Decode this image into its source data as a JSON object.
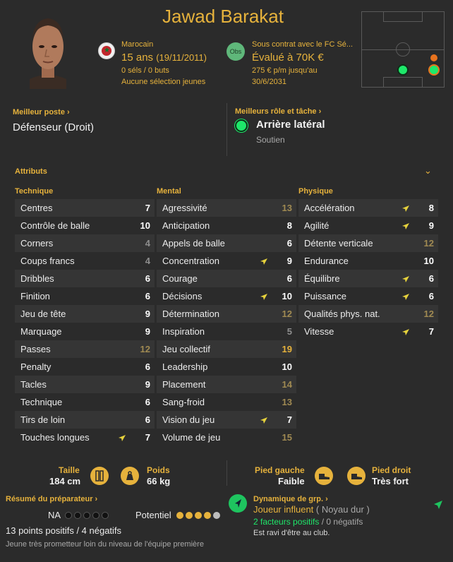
{
  "header": {
    "name": "Jawad Barakat",
    "nation": "Marocain",
    "age": "15 ans",
    "dob": "(19/11/2011)",
    "sels": "0 séls / 0 buts",
    "youth": "Aucune sélection jeunes",
    "obs_badge": "Obs",
    "contract": "Sous contrat avec le FC Sé...",
    "value": "Évalué à 70K €",
    "wage": "275 € p/m jusqu'au",
    "contract_end": "30/6/2031"
  },
  "best_position": {
    "title": "Meilleur poste",
    "value": "Défenseur (Droit)"
  },
  "best_role": {
    "title": "Meilleurs rôle et tâche",
    "value": "Arrière latéral",
    "duty": "Soutien"
  },
  "attributes": {
    "title": "Attributs",
    "columns": [
      {
        "title": "Technique",
        "rows": [
          {
            "label": "Centres",
            "value": "7",
            "tone": "hi",
            "arrow": false
          },
          {
            "label": "Contrôle de balle",
            "value": "10",
            "tone": "hi",
            "arrow": false
          },
          {
            "label": "Corners",
            "value": "4",
            "tone": "low",
            "arrow": false
          },
          {
            "label": "Coups francs",
            "value": "4",
            "tone": "low",
            "arrow": false
          },
          {
            "label": "Dribbles",
            "value": "6",
            "tone": "hi",
            "arrow": false
          },
          {
            "label": "Finition",
            "value": "6",
            "tone": "hi",
            "arrow": false
          },
          {
            "label": "Jeu de tête",
            "value": "9",
            "tone": "hi",
            "arrow": false
          },
          {
            "label": "Marquage",
            "value": "9",
            "tone": "hi",
            "arrow": false
          },
          {
            "label": "Passes",
            "value": "12",
            "tone": "mid",
            "arrow": false
          },
          {
            "label": "Penalty",
            "value": "6",
            "tone": "hi",
            "arrow": false
          },
          {
            "label": "Tacles",
            "value": "9",
            "tone": "hi",
            "arrow": false
          },
          {
            "label": "Technique",
            "value": "6",
            "tone": "hi",
            "arrow": false
          },
          {
            "label": "Tirs de loin",
            "value": "6",
            "tone": "hi",
            "arrow": false
          },
          {
            "label": "Touches longues",
            "value": "7",
            "tone": "hi",
            "arrow": true
          }
        ]
      },
      {
        "title": "Mental",
        "rows": [
          {
            "label": "Agressivité",
            "value": "13",
            "tone": "mid",
            "arrow": false
          },
          {
            "label": "Anticipation",
            "value": "8",
            "tone": "hi",
            "arrow": false
          },
          {
            "label": "Appels de balle",
            "value": "6",
            "tone": "hi",
            "arrow": false
          },
          {
            "label": "Concentration",
            "value": "9",
            "tone": "hi",
            "arrow": true
          },
          {
            "label": "Courage",
            "value": "6",
            "tone": "hi",
            "arrow": false
          },
          {
            "label": "Décisions",
            "value": "10",
            "tone": "hi",
            "arrow": true
          },
          {
            "label": "Détermination",
            "value": "12",
            "tone": "mid",
            "arrow": false
          },
          {
            "label": "Inspiration",
            "value": "5",
            "tone": "low",
            "arrow": false
          },
          {
            "label": "Jeu collectif",
            "value": "19",
            "tone": "gold",
            "arrow": false
          },
          {
            "label": "Leadership",
            "value": "10",
            "tone": "hi",
            "arrow": false
          },
          {
            "label": "Placement",
            "value": "14",
            "tone": "mid",
            "arrow": false
          },
          {
            "label": "Sang-froid",
            "value": "13",
            "tone": "mid",
            "arrow": false
          },
          {
            "label": "Vision du jeu",
            "value": "7",
            "tone": "hi",
            "arrow": true
          },
          {
            "label": "Volume de jeu",
            "value": "15",
            "tone": "mid",
            "arrow": false
          }
        ]
      },
      {
        "title": "Physique",
        "rows": [
          {
            "label": "Accélération",
            "value": "8",
            "tone": "hi",
            "arrow": true
          },
          {
            "label": "Agilité",
            "value": "9",
            "tone": "hi",
            "arrow": true
          },
          {
            "label": "Détente verticale",
            "value": "12",
            "tone": "mid",
            "arrow": false
          },
          {
            "label": "Endurance",
            "value": "10",
            "tone": "hi",
            "arrow": false
          },
          {
            "label": "Équilibre",
            "value": "6",
            "tone": "hi",
            "arrow": true
          },
          {
            "label": "Puissance",
            "value": "6",
            "tone": "hi",
            "arrow": true
          },
          {
            "label": "Qualités phys. nat.",
            "value": "12",
            "tone": "mid",
            "arrow": false
          },
          {
            "label": "Vitesse",
            "value": "7",
            "tone": "hi",
            "arrow": true
          }
        ]
      }
    ]
  },
  "physical": {
    "height_label": "Taille",
    "height_value": "184 cm",
    "weight_label": "Poids",
    "weight_value": "66 kg",
    "left_foot_label": "Pied gauche",
    "left_foot_value": "Faible",
    "right_foot_label": "Pied droit",
    "right_foot_value": "Très fort"
  },
  "summary": {
    "title": "Résumé du préparateur",
    "na_label": "NA",
    "potential_label": "Potentiel",
    "points": "13 points positifs / 4 négatifs",
    "note": "Jeune très prometteur loin du niveau de l'équipe première",
    "current_stars": 0,
    "potential_stars": 4
  },
  "dynamics": {
    "title": "Dynamique de grp.",
    "influence": "Joueur influent",
    "group": "( Noyau dur )",
    "positive": "2 facteurs positifs",
    "separator": " / ",
    "negative": "0 négatifs",
    "club": "Est ravi d'être au club."
  },
  "colors": {
    "accent": "#e6b23c",
    "background": "#2b2b2b",
    "positive": "#1ee86a"
  }
}
